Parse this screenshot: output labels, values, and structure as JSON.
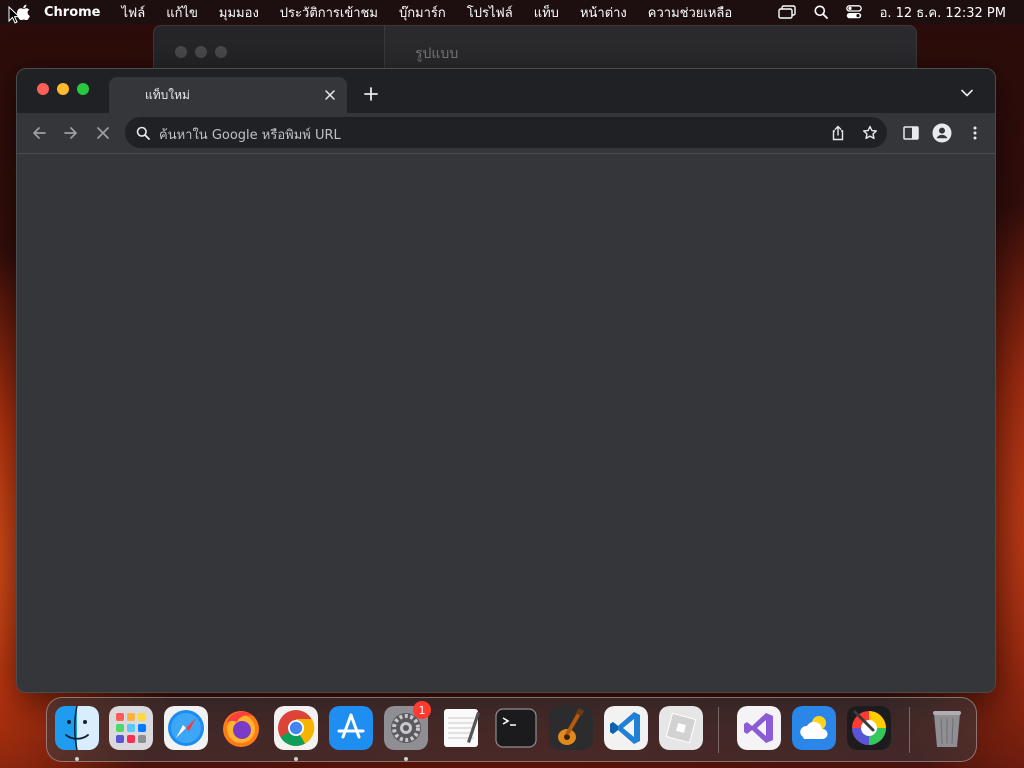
{
  "menubar": {
    "app_name": "Chrome",
    "items": [
      "ไฟล์",
      "แก้ไข",
      "มุมมอง",
      "ประวัติการเข้าชม",
      "บุ๊กมาร์ก",
      "โปรไฟล์",
      "แท็บ",
      "หน้าต่าง",
      "ความช่วยเหลือ"
    ],
    "datetime": "อ. 12 ธ.ค.  12:32 PM"
  },
  "background_window": {
    "title": "รูปแบบ"
  },
  "browser": {
    "tab_title": "แท็บใหม่",
    "omnibox_placeholder": "ค้นหาใน Google หรือพิมพ์ URL",
    "loading": true
  },
  "dock": {
    "apps": [
      {
        "name": "Finder",
        "icon": "finder-icon",
        "running": true
      },
      {
        "name": "Launchpad",
        "icon": "launchpad-icon",
        "running": false
      },
      {
        "name": "Safari",
        "icon": "safari-icon",
        "running": false
      },
      {
        "name": "Firefox",
        "icon": "firefox-icon",
        "running": false
      },
      {
        "name": "Google Chrome",
        "icon": "chrome-icon",
        "running": true
      },
      {
        "name": "App Store",
        "icon": "app-store-icon",
        "running": false
      },
      {
        "name": "System Settings",
        "icon": "system-settings-icon",
        "running": true,
        "badge": "1"
      },
      {
        "name": "TextEdit",
        "icon": "textedit-icon",
        "running": false
      },
      {
        "name": "Terminal",
        "icon": "terminal-icon",
        "running": false
      },
      {
        "name": "GarageBand",
        "icon": "garageband-icon",
        "running": false
      },
      {
        "name": "Visual Studio Code",
        "icon": "vscode-icon",
        "running": false
      },
      {
        "name": "Roblox",
        "icon": "roblox-icon",
        "running": false
      },
      {
        "name": "Visual Studio",
        "icon": "visual-studio-icon",
        "running": false
      },
      {
        "name": "Weather",
        "icon": "weather-icon",
        "running": false
      },
      {
        "name": "Color Picker",
        "icon": "color-picker-icon",
        "running": false
      },
      {
        "name": "Trash",
        "icon": "trash-icon",
        "running": false
      }
    ]
  },
  "colors": {
    "menubar_bg": "#1c1010",
    "chrome_frame": "#202124",
    "chrome_toolbar": "#35363a",
    "traffic_close": "#ff5f57",
    "traffic_min": "#febc2e",
    "traffic_max": "#28c840",
    "badge": "#ff3b30"
  }
}
